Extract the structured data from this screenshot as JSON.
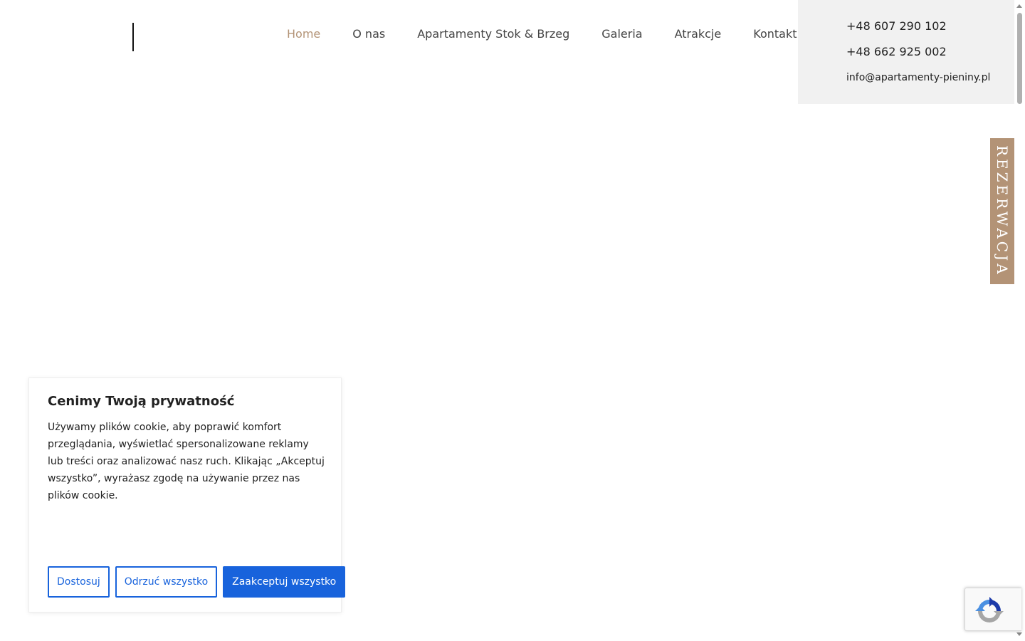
{
  "nav": {
    "items": [
      {
        "label": "Home",
        "active": true
      },
      {
        "label": "O nas"
      },
      {
        "label": "Apartamenty Stok & Brzeg"
      },
      {
        "label": "Galeria"
      },
      {
        "label": "Atrakcje"
      },
      {
        "label": "Kontakt"
      }
    ]
  },
  "contact": {
    "phone1": "+48 607 290 102",
    "phone2": "+48 662 925 002",
    "email": "info@apartamenty-pieniny.pl"
  },
  "reservation": {
    "label": "REZERWACJA"
  },
  "cookie": {
    "title": "Cenimy Twoją prywatność",
    "text": "Używamy plików cookie, aby poprawić komfort przeglądania, wyświetlać spersonalizowane reklamy lub treści oraz analizować nasz ruch. Klikając „Akceptuj wszystko”, wyrażasz zgodę na używanie przez nas plików cookie.",
    "customize_label": "Dostosuj",
    "reject_label": "Odrzuć wszystko",
    "accept_label": "Zaakceptuj wszystko"
  },
  "colors": {
    "accent": "#b39376",
    "cookie_primary": "#1863dc",
    "contact_bg": "#f1f1f1"
  },
  "icons": {
    "recaptcha": "recaptcha-icon"
  }
}
